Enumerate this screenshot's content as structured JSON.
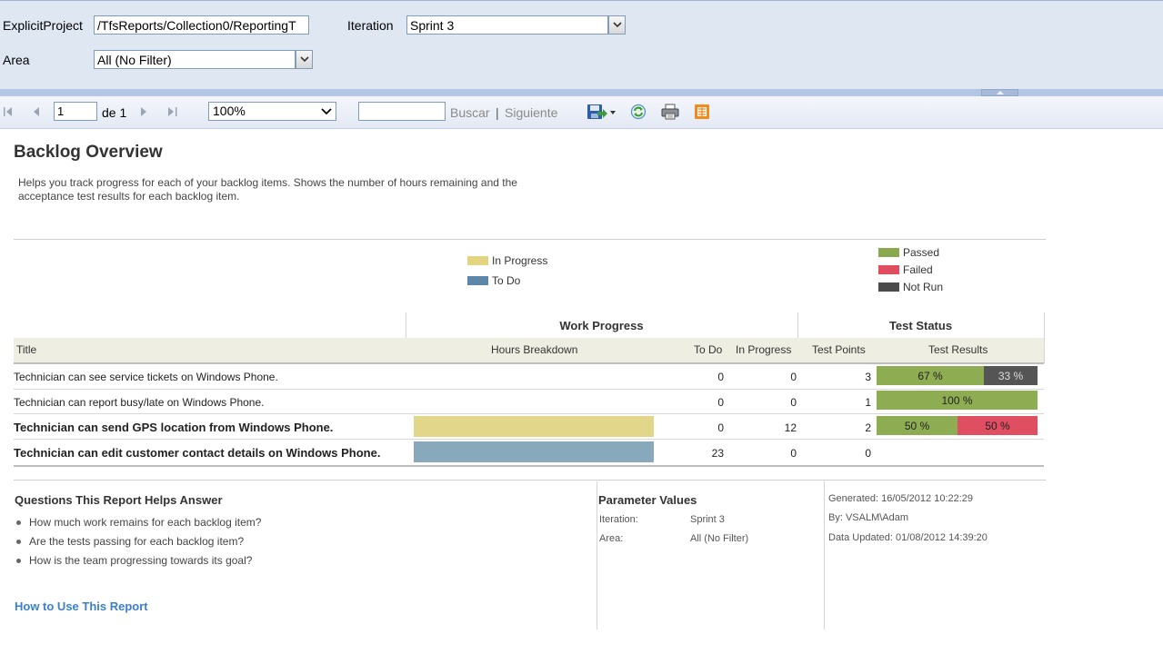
{
  "params": {
    "project_label": "ExplicitProject",
    "project_value": "/TfsReports/Collection0/ReportingT",
    "iteration_label": "Iteration",
    "iteration_value": "Sprint 3",
    "area_label": "Area",
    "area_value": "All (No Filter)"
  },
  "toolbar": {
    "page_value": "1",
    "page_of": "de 1",
    "zoom": "100%",
    "search_value": "",
    "find_label": "Buscar",
    "separator": "|",
    "next_label": "Siguiente",
    "icons": [
      "first-page-icon",
      "prev-page-icon",
      "next-page-icon",
      "last-page-icon",
      "export-save-icon",
      "refresh-icon",
      "print-icon",
      "data-feed-icon"
    ]
  },
  "report": {
    "title": "Backlog Overview",
    "description": "Helps you track progress for each of your backlog items. Shows the number of hours remaining and the acceptance test results for each backlog item.",
    "legend_work": [
      {
        "label": "In Progress",
        "color": "#e2d480"
      },
      {
        "label": "To Do",
        "color": "#5b87a8"
      }
    ],
    "legend_test": [
      {
        "label": "Passed",
        "color": "#8aa84d"
      },
      {
        "label": "Failed",
        "color": "#e04d5e"
      },
      {
        "label": "Not Run",
        "color": "#4a4a4a"
      }
    ],
    "group_headers": {
      "work": "Work Progress",
      "test": "Test Status"
    },
    "columns": {
      "title": "Title",
      "hours": "Hours Breakdown",
      "todo": "To Do",
      "inprogress": "In Progress",
      "points": "Test Points",
      "results": "Test Results"
    },
    "rows": [
      {
        "title": "Technician can see service tickets on Windows Phone.",
        "bold": false,
        "todo": "0",
        "inprogress": "0",
        "points": "3",
        "results": [
          {
            "label": "67 %",
            "pct": 67,
            "kind": "passed"
          },
          {
            "label": "33 %",
            "pct": 33,
            "kind": "notrun"
          }
        ]
      },
      {
        "title": "Technician can report busy/late on Windows Phone.",
        "bold": false,
        "todo": "0",
        "inprogress": "0",
        "points": "1",
        "results": [
          {
            "label": "100 %",
            "pct": 100,
            "kind": "passed"
          }
        ]
      },
      {
        "title": "Technician can send GPS location from Windows Phone.",
        "bold": true,
        "todo": "0",
        "inprogress": "12",
        "points": "2",
        "hours_kind": "inprogress",
        "results": [
          {
            "label": "50 %",
            "pct": 50,
            "kind": "passed"
          },
          {
            "label": "50 %",
            "pct": 50,
            "kind": "failed"
          }
        ]
      },
      {
        "title": "Technician can edit customer contact details on Windows Phone.",
        "bold": true,
        "todo": "23",
        "inprogress": "0",
        "points": "0",
        "hours_kind": "todo",
        "results": []
      }
    ],
    "bar_colors": {
      "inprogress": "#e2d68a",
      "todo": "#88a9bb",
      "passed": "#8eac52",
      "failed": "#df4f61",
      "notrun": "#555555"
    }
  },
  "footer": {
    "questions_title": "Questions This Report Helps Answer",
    "questions": [
      "How much work remains for each backlog item?",
      "Are the tests passing for each backlog item?",
      "How is the team progressing towards its goal?"
    ],
    "how_to_link": "How to Use This Report",
    "param_title": "Parameter Values",
    "param_iteration_label": "Iteration:",
    "param_iteration_value": "Sprint 3",
    "param_area_label": "Area:",
    "param_area_value": "All (No Filter)",
    "generated": "Generated: 16/05/2012 10:22:29",
    "by": "By: VSALM\\Adam",
    "data_updated": "Data Updated: 01/08/2012 14:39:20"
  }
}
